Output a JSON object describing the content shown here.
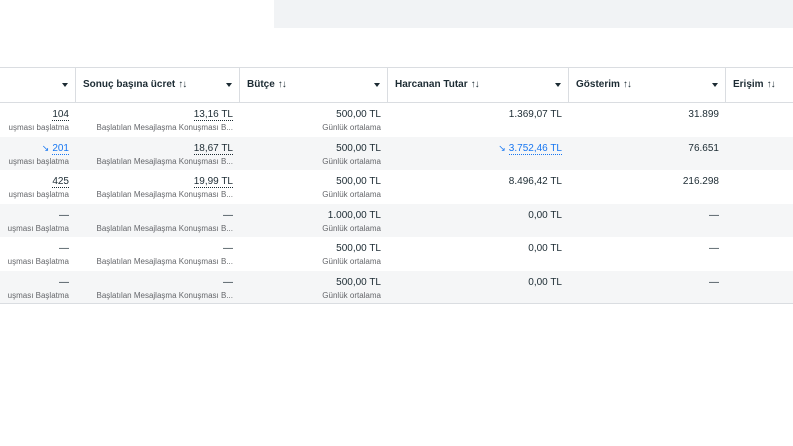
{
  "columns": [
    {
      "id": "results",
      "label": "",
      "sortable": false,
      "dropdown": true
    },
    {
      "id": "cost_per_result",
      "label": "Sonuç başına ücret",
      "sort_icon": "↑↓",
      "dropdown": true
    },
    {
      "id": "budget",
      "label": "Bütçe",
      "sort_icon": "↑↓",
      "dropdown": true
    },
    {
      "id": "amount_spent",
      "label": "Harcanan Tutar",
      "sort_icon": "↑↓",
      "dropdown": true
    },
    {
      "id": "impressions",
      "label": "Gösterim",
      "sort_icon": "↑↓",
      "dropdown": true
    },
    {
      "id": "reach",
      "label": "Erişim",
      "sort_icon": "↑↓",
      "dropdown": false
    }
  ],
  "rows": [
    {
      "results": {
        "value": "104",
        "sub": "uşması başlatma",
        "trend": false,
        "style": "dotted"
      },
      "cost": {
        "value": "13,16 TL",
        "sub": "Başlatılan Mesajlaşma Konuşması B...",
        "style": "dotted"
      },
      "budget": {
        "value": "500,00 TL",
        "sub": "Günlük ortalama"
      },
      "spent": {
        "value": "1.369,07 TL",
        "trend": false
      },
      "impressions": {
        "value": "31.899"
      }
    },
    {
      "results": {
        "value": "201",
        "sub": "uşması başlatma",
        "trend": true,
        "style": "link"
      },
      "cost": {
        "value": "18,67 TL",
        "sub": "Başlatılan Mesajlaşma Konuşması B...",
        "style": "dotted"
      },
      "budget": {
        "value": "500,00 TL",
        "sub": "Günlük ortalama"
      },
      "spent": {
        "value": "3.752,46 TL",
        "trend": true
      },
      "impressions": {
        "value": "76.651"
      }
    },
    {
      "results": {
        "value": "425",
        "sub": "uşması başlatma",
        "trend": false,
        "style": "dotted"
      },
      "cost": {
        "value": "19,99 TL",
        "sub": "Başlatılan Mesajlaşma Konuşması B...",
        "style": "dotted"
      },
      "budget": {
        "value": "500,00 TL",
        "sub": "Günlük ortalama"
      },
      "spent": {
        "value": "8.496,42 TL",
        "trend": false
      },
      "impressions": {
        "value": "216.298"
      }
    },
    {
      "results": {
        "value": "—",
        "sub": "uşması Başlatma",
        "trend": false,
        "style": "plain"
      },
      "cost": {
        "value": "—",
        "sub": "Başlatılan Mesajlaşma Konuşması B...",
        "style": "plain"
      },
      "budget": {
        "value": "1.000,00 TL",
        "sub": "Günlük ortalama"
      },
      "spent": {
        "value": "0,00 TL",
        "trend": false
      },
      "impressions": {
        "value": "—"
      }
    },
    {
      "results": {
        "value": "—",
        "sub": "uşması Başlatma",
        "trend": false,
        "style": "plain"
      },
      "cost": {
        "value": "—",
        "sub": "Başlatılan Mesajlaşma Konuşması B...",
        "style": "plain"
      },
      "budget": {
        "value": "500,00 TL",
        "sub": "Günlük ortalama"
      },
      "spent": {
        "value": "0,00 TL",
        "trend": false
      },
      "impressions": {
        "value": "—"
      }
    },
    {
      "results": {
        "value": "—",
        "sub": "uşması Başlatma",
        "trend": false,
        "style": "plain"
      },
      "cost": {
        "value": "—",
        "sub": "Başlatılan Mesajlaşma Konuşması B...",
        "style": "plain"
      },
      "budget": {
        "value": "500,00 TL",
        "sub": "Günlük ortalama"
      },
      "spent": {
        "value": "0,00 TL",
        "trend": false
      },
      "impressions": {
        "value": "—"
      }
    }
  ],
  "trend_icon": "↘",
  "colors": {
    "link": "#1877f2",
    "text": "#1c2b33",
    "muted": "#65676b",
    "border": "#dadde1",
    "alt_row": "#f5f6f7"
  }
}
